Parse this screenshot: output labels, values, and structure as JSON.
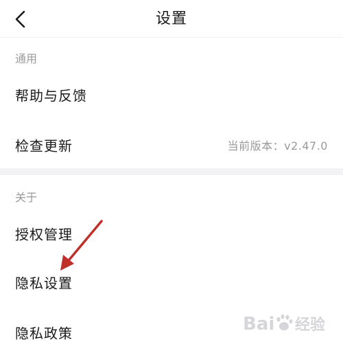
{
  "header": {
    "title": "设置",
    "back_icon": "chevron-left-icon"
  },
  "sections": {
    "general": {
      "label": "通用",
      "items": [
        {
          "label": "帮助与反馈"
        },
        {
          "label": "检查更新",
          "value": "当前版本：v2.47.0"
        }
      ]
    },
    "about": {
      "label": "关于",
      "items": [
        {
          "label": "授权管理"
        },
        {
          "label": "隐私设置"
        },
        {
          "label": "隐私政策"
        }
      ]
    }
  },
  "annotation": {
    "arrow_color": "#c0302b",
    "target": "隐私设置"
  },
  "watermark": {
    "text": "Bai经验",
    "icon": "baidu-paw-icon"
  }
}
